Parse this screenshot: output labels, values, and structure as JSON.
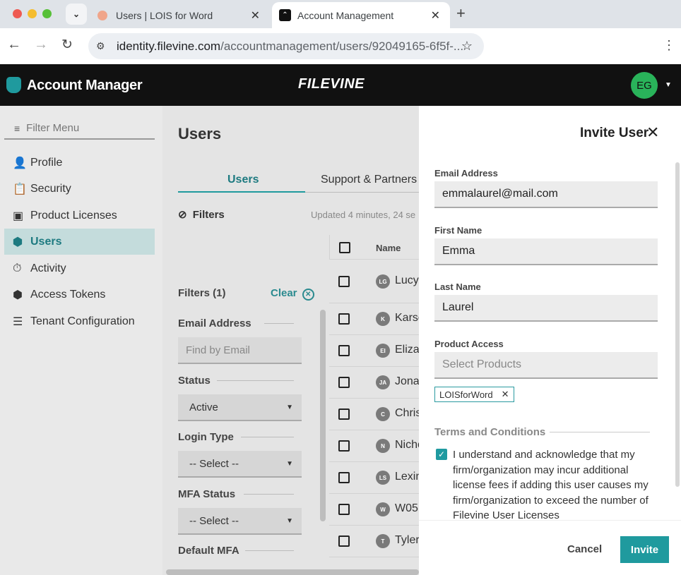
{
  "browser": {
    "tabs": [
      {
        "title": "Users | LOIS for Word"
      },
      {
        "title": "Account Management"
      }
    ],
    "url_host": "identity.filevine.com",
    "url_path": "/accountmanagement/users/92049165-6f5f-..."
  },
  "appbar": {
    "brand": "Account Manager",
    "logo": "FILEVINE",
    "avatar_initials": "EG"
  },
  "sidebar": {
    "filter_placeholder": "Filter Menu",
    "items": [
      {
        "label": "Profile",
        "icon": "person-icon"
      },
      {
        "label": "Security",
        "icon": "clipboard-icon"
      },
      {
        "label": "Product Licenses",
        "icon": "license-icon"
      },
      {
        "label": "Users",
        "icon": "cube-icon",
        "selected": true
      },
      {
        "label": "Activity",
        "icon": "activity-icon"
      },
      {
        "label": "Access Tokens",
        "icon": "token-icon"
      },
      {
        "label": "Tenant Configuration",
        "icon": "sliders-icon"
      }
    ]
  },
  "main": {
    "title": "Users",
    "tabs": [
      "Users",
      "Support & Partners"
    ],
    "filters_label": "Filters",
    "updated_text": "Updated 4 minutes, 24 se",
    "filters_count": "Filters (1)",
    "clear_label": "Clear",
    "email_label": "Email Address",
    "email_placeholder": "Find by Email",
    "status_label": "Status",
    "status_value": "Active",
    "login_type_label": "Login Type",
    "login_type_value": "-- Select --",
    "mfa_status_label": "MFA Status",
    "mfa_status_value": "-- Select --",
    "default_mfa_label": "Default MFA"
  },
  "table": {
    "header_name": "Name",
    "rows": [
      {
        "initials": "LG",
        "name": "Lucy"
      },
      {
        "initials": "K",
        "name": "Karso"
      },
      {
        "initials": "EI",
        "name": "Eliza"
      },
      {
        "initials": "JA",
        "name": "Jona"
      },
      {
        "initials": "C",
        "name": "Chris"
      },
      {
        "initials": "N",
        "name": "Nicho"
      },
      {
        "initials": "LS",
        "name": "Lexin"
      },
      {
        "initials": "W",
        "name": "W05"
      },
      {
        "initials": "T",
        "name": "Tyler"
      }
    ]
  },
  "modal": {
    "title": "Invite User",
    "email_label": "Email Address",
    "email_value": "emmalaurel@mail.com",
    "first_name_label": "First Name",
    "first_name_value": "Emma",
    "last_name_label": "Last Name",
    "last_name_value": "Laurel",
    "product_access_label": "Product Access",
    "product_access_placeholder": "Select Products",
    "product_chip": "LOISforWord",
    "terms_label": "Terms and Conditions",
    "terms_text": "I understand and acknowledge that my firm/organization may incur additional license fees if adding this user causes my firm/organization to exceed the number of Filevine User Licenses",
    "cancel_label": "Cancel",
    "invite_label": "Invite"
  },
  "colors": {
    "accent": "#1f9a9e",
    "sidebar_selected_bg": "#c4dcdc",
    "appbar_bg": "#111111",
    "avatar_bg": "#29b35a"
  }
}
